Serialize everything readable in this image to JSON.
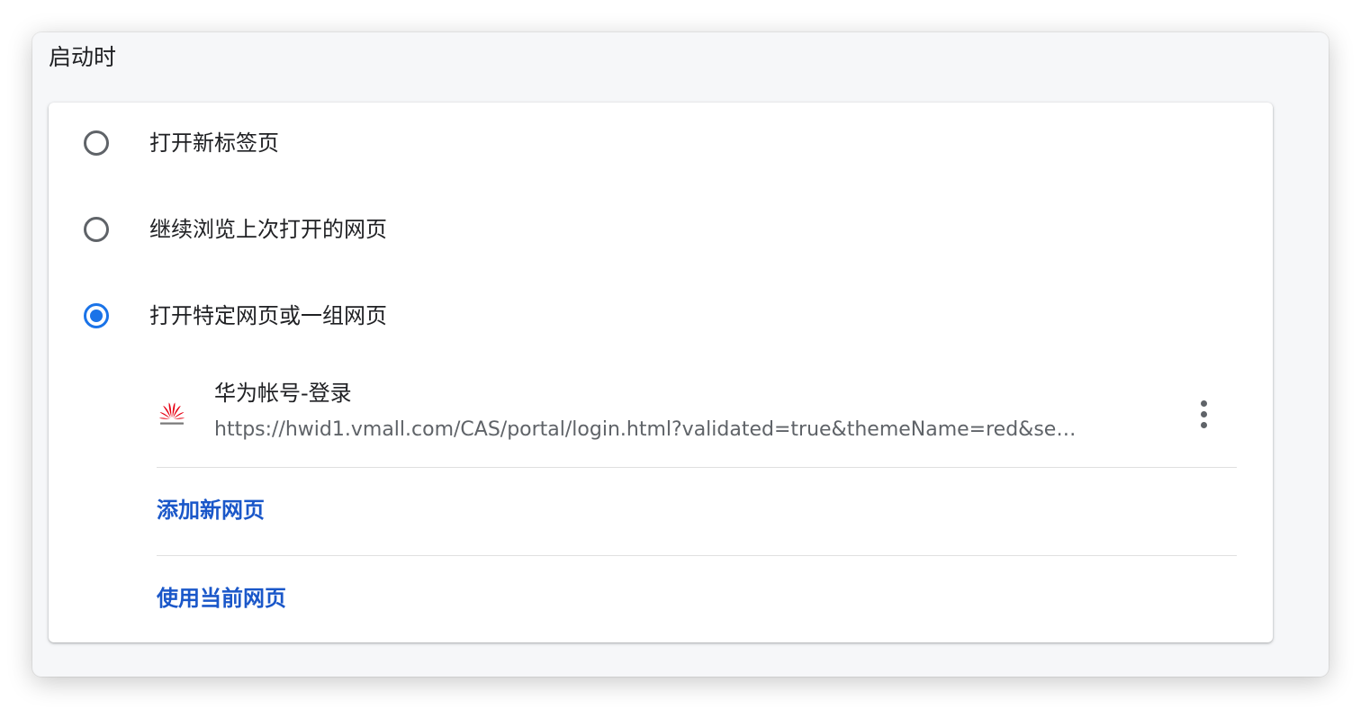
{
  "section": {
    "title": "启动时"
  },
  "startup": {
    "options": [
      {
        "label": "打开新标签页",
        "checked": false
      },
      {
        "label": "继续浏览上次打开的网页",
        "checked": false
      },
      {
        "label": "打开特定网页或一组网页",
        "checked": true
      }
    ],
    "pages": [
      {
        "title": "华为帐号-登录",
        "url": "https://hwid1.vmall.com/CAS/portal/login.html?validated=true&themeName=red&se…",
        "favicon": "huawei-logo-icon"
      }
    ],
    "add_page_label": "添加新网页",
    "use_current_label": "使用当前网页"
  },
  "colors": {
    "accent": "#1a73e8",
    "link": "#1a57c9",
    "huawei_red": "#e60012"
  }
}
